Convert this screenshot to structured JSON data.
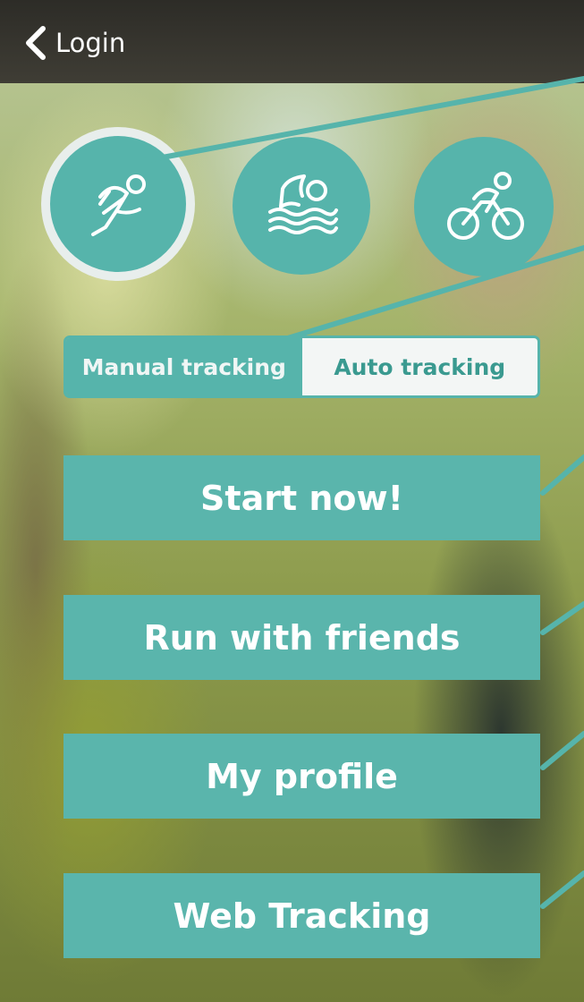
{
  "navbar": {
    "back_label": "Login"
  },
  "sports": {
    "running_icon": "running-icon",
    "swimming_icon": "swimming-icon",
    "cycling_icon": "cycling-icon",
    "selected": "running"
  },
  "tracking": {
    "manual_label": "Manual tracking",
    "auto_label": "Auto tracking",
    "selected": "manual"
  },
  "buttons": {
    "start": "Start now!",
    "friends": "Run with friends",
    "profile": "My profile",
    "web": "Web Tracking"
  },
  "colors": {
    "accent": "#56b4ab",
    "navbar": "#3a3832",
    "toggle_inactive": "#f3f6f5"
  }
}
